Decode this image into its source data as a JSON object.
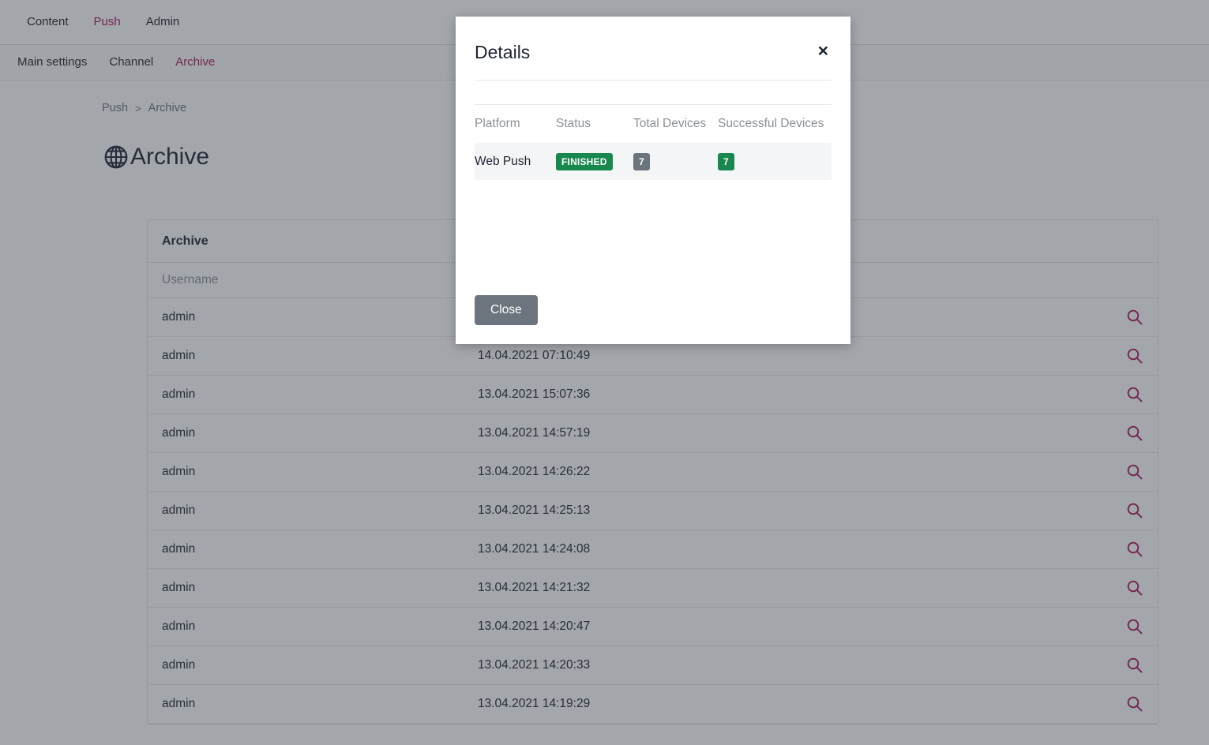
{
  "topnav": {
    "items": [
      {
        "label": "Content",
        "active": false
      },
      {
        "label": "Push",
        "active": true
      },
      {
        "label": "Admin",
        "active": false
      }
    ]
  },
  "subnav": {
    "items": [
      {
        "label": "Main settings",
        "active": false
      },
      {
        "label": "Channel",
        "active": false
      },
      {
        "label": "Archive",
        "active": true
      }
    ]
  },
  "breadcrumb": {
    "parent": "Push",
    "separator": ">",
    "current": "Archive"
  },
  "page": {
    "title": "Archive",
    "icon": "globe-icon"
  },
  "archive_card": {
    "header": "Archive",
    "columns": [
      "Username",
      "",
      "",
      ""
    ],
    "column_username": "Username",
    "rows": [
      {
        "username": "admin",
        "date": "",
        "action_icon": "search-icon"
      },
      {
        "username": "admin",
        "date": "14.04.2021 07:10:49",
        "action_icon": "search-icon"
      },
      {
        "username": "admin",
        "date": "13.04.2021 15:07:36",
        "action_icon": "search-icon"
      },
      {
        "username": "admin",
        "date": "13.04.2021 14:57:19",
        "action_icon": "search-icon"
      },
      {
        "username": "admin",
        "date": "13.04.2021 14:26:22",
        "action_icon": "search-icon"
      },
      {
        "username": "admin",
        "date": "13.04.2021 14:25:13",
        "action_icon": "search-icon"
      },
      {
        "username": "admin",
        "date": "13.04.2021 14:24:08",
        "action_icon": "search-icon"
      },
      {
        "username": "admin",
        "date": "13.04.2021 14:21:32",
        "action_icon": "search-icon"
      },
      {
        "username": "admin",
        "date": "13.04.2021 14:20:47",
        "action_icon": "search-icon"
      },
      {
        "username": "admin",
        "date": "13.04.2021 14:20:33",
        "action_icon": "search-icon"
      },
      {
        "username": "admin",
        "date": "13.04.2021 14:19:29",
        "action_icon": "search-icon"
      }
    ]
  },
  "modal": {
    "title": "Details",
    "close_icon": "×",
    "columns": {
      "platform": "Platform",
      "status": "Status",
      "total_devices": "Total Devices",
      "successful_devices": "Successful Devices"
    },
    "rows": [
      {
        "platform": "Web Push",
        "status": "FINISHED",
        "total_devices": "7",
        "successful_devices": "7"
      }
    ],
    "close_button": "Close"
  },
  "colors": {
    "accent": "#a6165c",
    "success": "#18884f",
    "secondary": "#6c757d",
    "text": "#1d2430",
    "muted": "#8b9099",
    "overlay": "rgba(51,58,69,0.45)"
  }
}
